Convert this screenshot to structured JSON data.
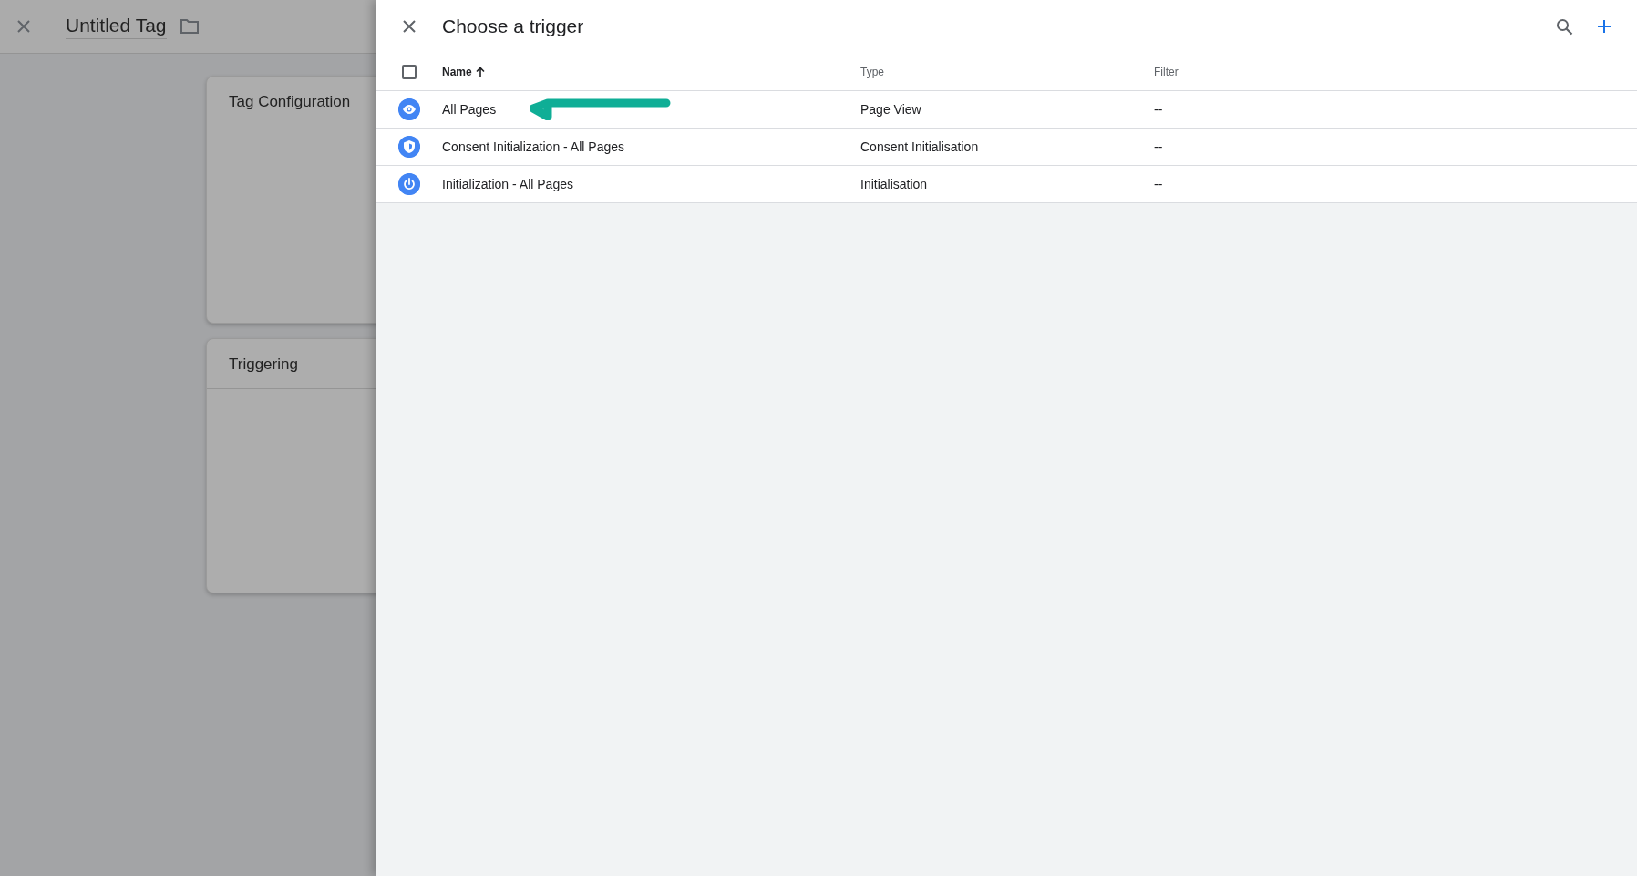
{
  "editor": {
    "title": "Untitled Tag",
    "cards": [
      {
        "title": "Tag Configuration",
        "divided": false
      },
      {
        "title": "Triggering",
        "divided": true
      }
    ]
  },
  "trigger_panel": {
    "title": "Choose a trigger",
    "select_all": {
      "checked": false
    },
    "columns": [
      {
        "label": "Name",
        "sorted": true
      },
      {
        "label": "Type",
        "sorted": false
      },
      {
        "label": "Filter",
        "sorted": false
      }
    ],
    "rows": [
      {
        "kind": "pageview",
        "name": "All Pages",
        "type": "Page View",
        "filter": "--",
        "pointed": true
      },
      {
        "kind": "consent",
        "name": "Consent Initialization - All Pages",
        "type": "Consent Initialisation",
        "filter": "--",
        "pointed": false
      },
      {
        "kind": "init",
        "name": "Initialization - All Pages",
        "type": "Initialisation",
        "filter": "--",
        "pointed": false
      }
    ]
  }
}
